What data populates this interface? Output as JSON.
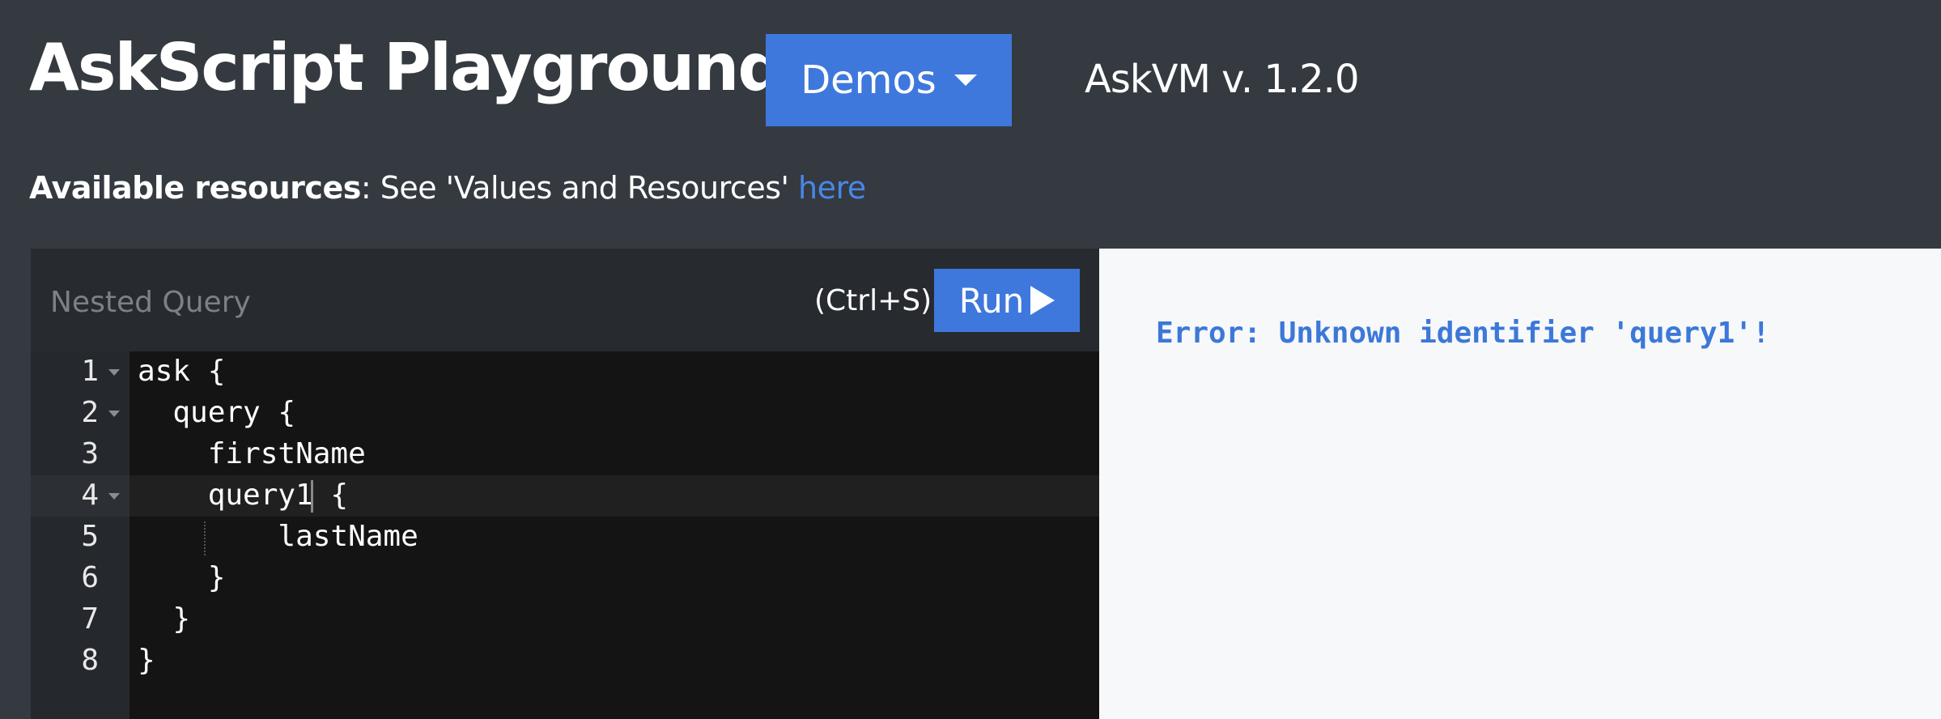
{
  "header": {
    "title": "AskScript Playground",
    "demos_label": "Demos",
    "version": "AskVM v. 1.2.0"
  },
  "resources": {
    "bold_label": "Available resources",
    "text": ": See 'Values and Resources' ",
    "link": "here"
  },
  "editor": {
    "query_name": "Nested Query",
    "shortcut": "(Ctrl+S)",
    "run_label": "Run",
    "lines": [
      {
        "num": "1",
        "code": "ask {"
      },
      {
        "num": "2",
        "code": "  query {"
      },
      {
        "num": "3",
        "code": "    firstName"
      },
      {
        "num": "4",
        "code": "    query1 {"
      },
      {
        "num": "5",
        "code": "        lastName"
      },
      {
        "num": "6",
        "code": "    }"
      },
      {
        "num": "7",
        "code": "  }"
      },
      {
        "num": "8",
        "code": "}"
      }
    ]
  },
  "output": {
    "error": "Error: Unknown identifier 'query1'!"
  },
  "colors": {
    "accent": "#3f78dd",
    "background": "#343a40",
    "editor_bg": "#141414",
    "error": "#3c78d8"
  }
}
